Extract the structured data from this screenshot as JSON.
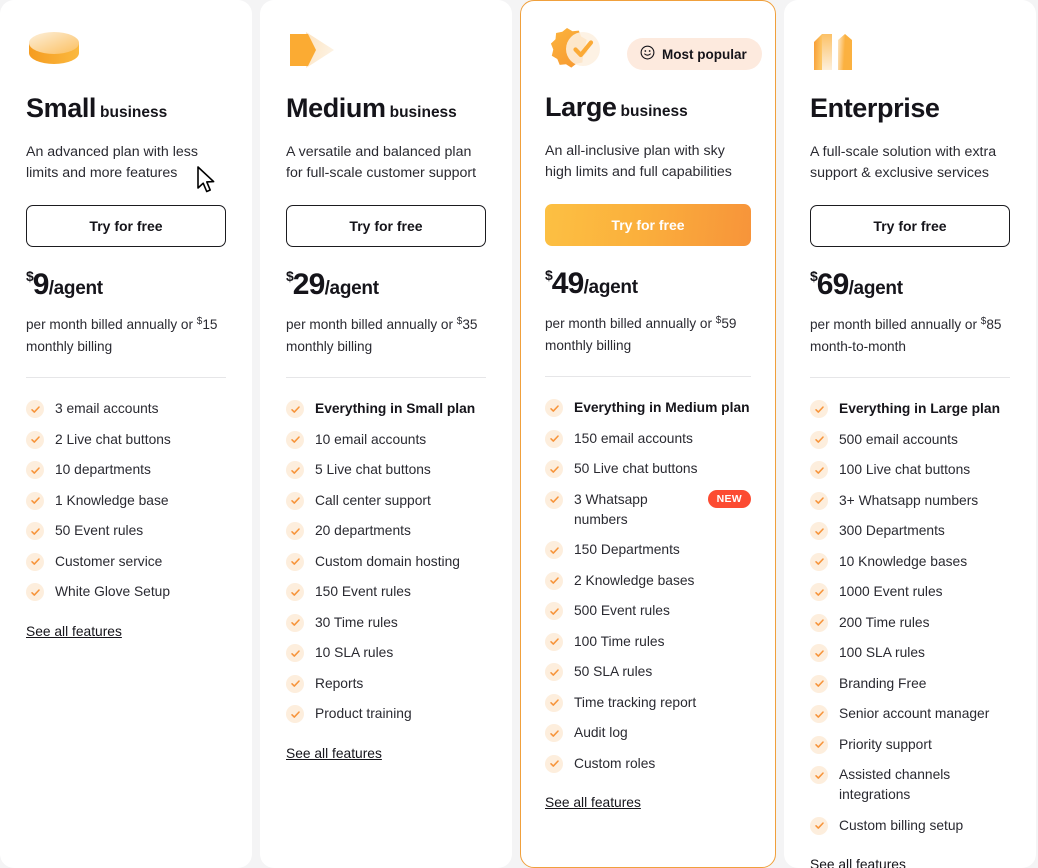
{
  "plans": [
    {
      "id": "small",
      "icon": "disc-icon",
      "title": "Small",
      "title_suffix": "business",
      "description": "An advanced plan with less limits and more features",
      "cta_label": "Try for free",
      "cta_style": "outline",
      "currency": "$",
      "price": "9",
      "per_unit": "/agent",
      "price_note_parts": [
        {
          "text": "per month billed annually"
        },
        {
          "text": "or "
        },
        {
          "sup": "$"
        },
        {
          "text": "15 monthly billing"
        }
      ],
      "price_note": "per month billed annually or $15 monthly billing",
      "featured": false,
      "badge": null,
      "features": [
        {
          "label": "3 email accounts",
          "strong": false,
          "badge": null
        },
        {
          "label": "2 Live chat buttons",
          "strong": false,
          "badge": null
        },
        {
          "label": "10 departments",
          "strong": false,
          "badge": null
        },
        {
          "label": "1 Knowledge base",
          "strong": false,
          "badge": null
        },
        {
          "label": "50 Event rules",
          "strong": false,
          "badge": null
        },
        {
          "label": "Customer service",
          "strong": false,
          "badge": null
        },
        {
          "label": "White Glove Setup",
          "strong": false,
          "badge": null
        }
      ],
      "see_all_label": "See all features"
    },
    {
      "id": "medium",
      "icon": "double-chevron-icon",
      "title": "Medium",
      "title_suffix": "business",
      "description": "A versatile and balanced plan for full-scale customer support",
      "cta_label": "Try for free",
      "cta_style": "outline",
      "currency": "$",
      "price": "29",
      "per_unit": "/agent",
      "price_note": "per month billed annually or $35 monthly billing",
      "featured": false,
      "badge": null,
      "features": [
        {
          "label": "Everything in Small plan",
          "strong": true,
          "badge": null
        },
        {
          "label": "10 email accounts",
          "strong": false,
          "badge": null
        },
        {
          "label": "5 Live chat buttons",
          "strong": false,
          "badge": null
        },
        {
          "label": "Call center support",
          "strong": false,
          "badge": null
        },
        {
          "label": "20 departments",
          "strong": false,
          "badge": null
        },
        {
          "label": "Custom domain hosting",
          "strong": false,
          "badge": null
        },
        {
          "label": "150 Event rules",
          "strong": false,
          "badge": null
        },
        {
          "label": "30 Time rules",
          "strong": false,
          "badge": null
        },
        {
          "label": "10 SLA rules",
          "strong": false,
          "badge": null
        },
        {
          "label": "Reports",
          "strong": false,
          "badge": null
        },
        {
          "label": "Product training",
          "strong": false,
          "badge": null
        }
      ],
      "see_all_label": "See all features"
    },
    {
      "id": "large",
      "icon": "badge-check-icon",
      "title": "Large",
      "title_suffix": "business",
      "description": "An all-inclusive plan with sky high limits and full capabilities",
      "cta_label": "Try for free",
      "cta_style": "primary",
      "currency": "$",
      "price": "49",
      "per_unit": "/agent",
      "price_note": "per month billed annually or $59 monthly billing",
      "featured": true,
      "badge": {
        "label": "Most popular",
        "icon": "smiley-icon"
      },
      "features": [
        {
          "label": "Everything in Medium plan",
          "strong": true,
          "badge": null
        },
        {
          "label": "150 email accounts",
          "strong": false,
          "badge": null
        },
        {
          "label": "50 Live chat buttons",
          "strong": false,
          "badge": null
        },
        {
          "label": "3 Whatsapp numbers",
          "strong": false,
          "badge": "NEW"
        },
        {
          "label": "150 Departments",
          "strong": false,
          "badge": null
        },
        {
          "label": "2 Knowledge bases",
          "strong": false,
          "badge": null
        },
        {
          "label": "500 Event rules",
          "strong": false,
          "badge": null
        },
        {
          "label": "100 Time rules",
          "strong": false,
          "badge": null
        },
        {
          "label": "50 SLA rules",
          "strong": false,
          "badge": null
        },
        {
          "label": "Time tracking report",
          "strong": false,
          "badge": null
        },
        {
          "label": "Audit log",
          "strong": false,
          "badge": null
        },
        {
          "label": "Custom roles",
          "strong": false,
          "badge": null
        }
      ],
      "see_all_label": "See all features"
    },
    {
      "id": "enterprise",
      "icon": "buildings-icon",
      "title": "Enterprise",
      "title_suffix": "",
      "description": "A full-scale solution with extra support & exclusive services",
      "cta_label": "Try for free",
      "cta_style": "outline",
      "currency": "$",
      "price": "69",
      "per_unit": "/agent",
      "price_note": "per month billed annually or $85 month-to-month",
      "featured": false,
      "badge": null,
      "features": [
        {
          "label": "Everything in Large plan",
          "strong": true,
          "badge": null
        },
        {
          "label": "500 email accounts",
          "strong": false,
          "badge": null
        },
        {
          "label": "100 Live chat buttons",
          "strong": false,
          "badge": null
        },
        {
          "label": "3+ Whatsapp numbers",
          "strong": false,
          "badge": null
        },
        {
          "label": "300 Departments",
          "strong": false,
          "badge": null
        },
        {
          "label": "10 Knowledge bases",
          "strong": false,
          "badge": null
        },
        {
          "label": "1000 Event rules",
          "strong": false,
          "badge": null
        },
        {
          "label": "200 Time rules",
          "strong": false,
          "badge": null
        },
        {
          "label": "100 SLA rules",
          "strong": false,
          "badge": null
        },
        {
          "label": "Branding Free",
          "strong": false,
          "badge": null
        },
        {
          "label": "Senior account manager",
          "strong": false,
          "badge": null
        },
        {
          "label": "Priority support",
          "strong": false,
          "badge": null
        },
        {
          "label": "Assisted channels integrations",
          "strong": false,
          "badge": null
        },
        {
          "label": "Custom billing setup",
          "strong": false,
          "badge": null
        }
      ],
      "see_all_label": "See all features"
    }
  ],
  "theme": {
    "accent": "#f7943a",
    "accent_light": "#fcc043",
    "badge_bg": "#fdeade",
    "new_badge_bg": "#fc4b32",
    "check_bg": "#fdeedd",
    "page_bg": "#f4f4f5",
    "card_bg": "#ffffff",
    "text": "#15141a"
  }
}
